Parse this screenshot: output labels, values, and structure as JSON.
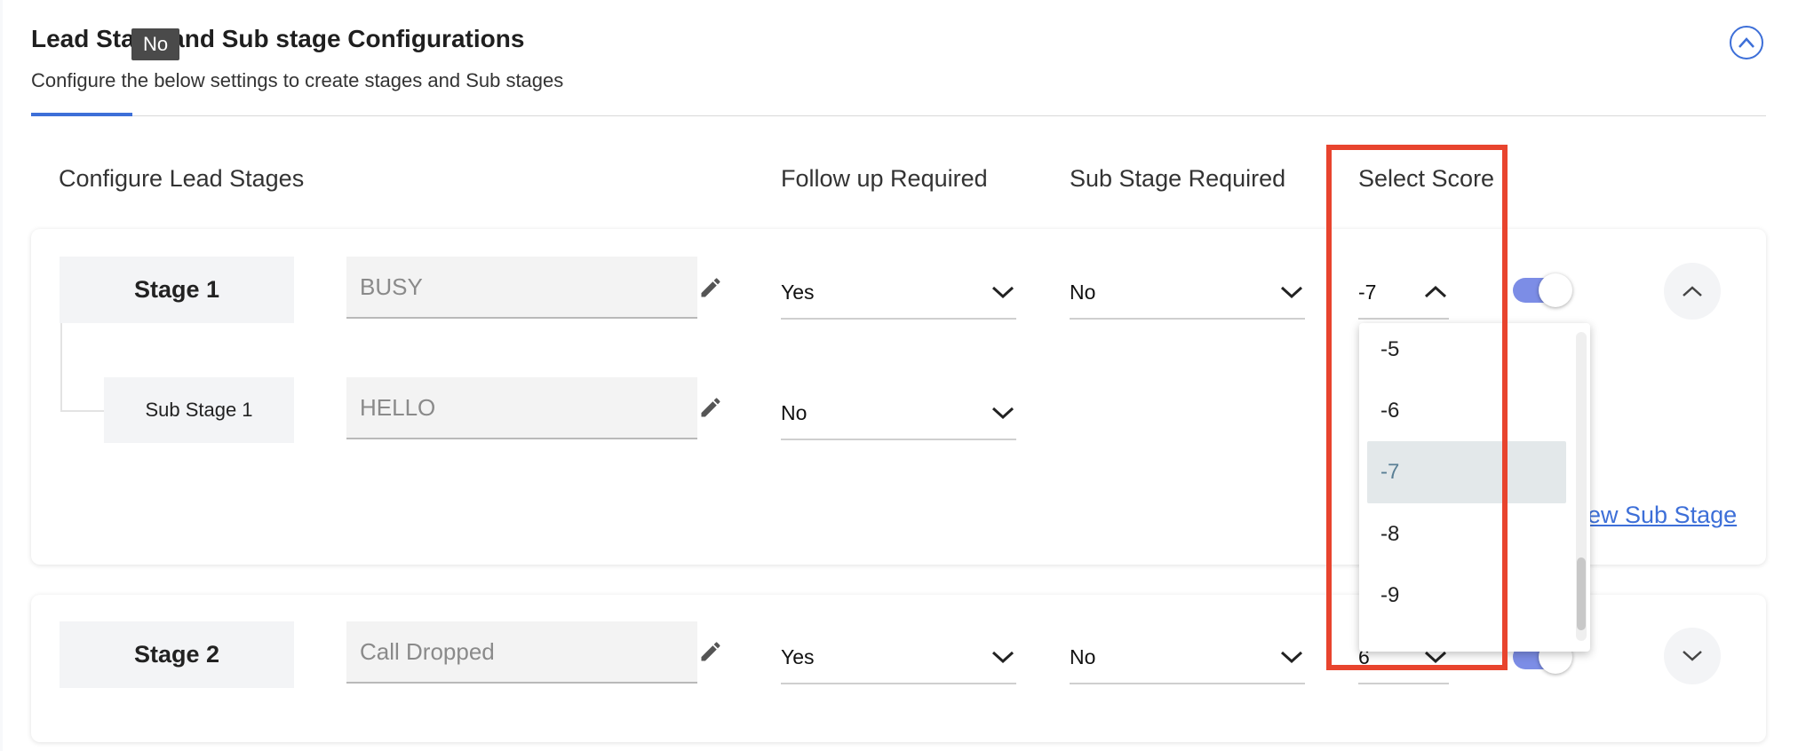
{
  "header": {
    "title": "Lead Stage and Sub stage Configurations",
    "subtitle": "Configure the below settings to create stages and Sub stages",
    "tooltip": "No"
  },
  "columns": {
    "configure_lead_stages": "Configure Lead Stages",
    "follow_up_required": "Follow up Required",
    "sub_stage_required": "Sub Stage Required",
    "select_score": "Select Score"
  },
  "stage1": {
    "label": "Stage 1",
    "name_value": "BUSY",
    "follow_up": "Yes",
    "sub_stage_required": "No",
    "score": "-7",
    "sub_stage": {
      "label": "Sub Stage 1",
      "name_value": "HELLO",
      "follow_up": "No"
    },
    "add_sub_stage_link": "ew Sub Stage"
  },
  "stage2": {
    "label": "Stage 2",
    "name_value": "Call Dropped",
    "follow_up": "Yes",
    "sub_stage_required": "No",
    "score": "6"
  },
  "score_dropdown": {
    "options": [
      "-5",
      "-6",
      "-7",
      "-8",
      "-9"
    ],
    "selected": "-7"
  },
  "colors": {
    "accent": "#3d6fd8",
    "highlight": "#e8442e",
    "toggle": "#7c8de6"
  }
}
